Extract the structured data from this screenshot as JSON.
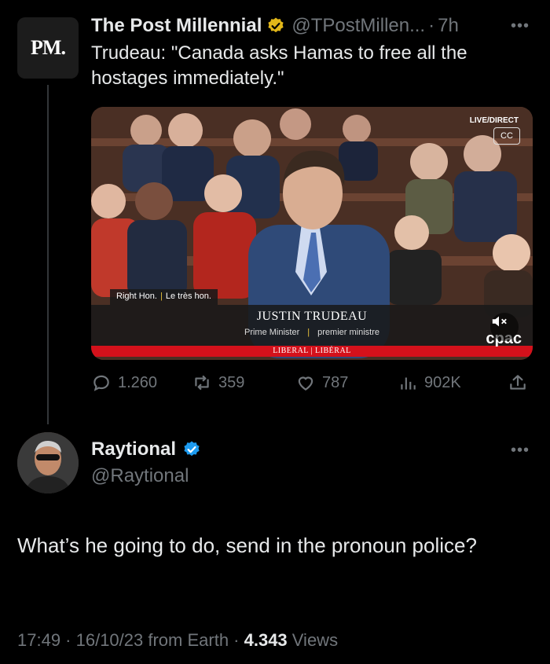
{
  "parent_tweet": {
    "avatar_text": "PM.",
    "name": "The Post Millennial",
    "handle": "@TPostMillen...",
    "time": "7h",
    "text": "Trudeau: \"Canada asks Hamas to free all the hostages immediately.\"",
    "media": {
      "live_tag": "LIVE/DIRECT",
      "cc_label": "CC",
      "title_left": "Right Hon.",
      "title_right": "Le très hon.",
      "speaker_name": "JUSTIN TRUDEAU",
      "role_en": "Prime Minister",
      "role_fr": "premier ministre",
      "party": "LIBERAL | LIBÉRAL",
      "broadcaster": "cpac"
    },
    "stats": {
      "replies": "1.260",
      "reposts": "359",
      "likes": "787",
      "views": "902K"
    }
  },
  "reply_tweet": {
    "name": "Raytional",
    "handle": "@Raytional",
    "text": "What’s he going to do, send in the pronoun police?",
    "meta_time": "17:49 · 16/10/23 from Earth · ",
    "meta_views_count": "4.343",
    "meta_views_label": " Views"
  },
  "colors": {
    "background": "#000000",
    "text_primary": "#e7e9ea",
    "text_secondary": "#71767b",
    "verified_gold": "#e2b719",
    "verified_blue": "#1d9bf0",
    "party_red": "#d4111b"
  },
  "icons": [
    "more-icon",
    "gold-verified-icon",
    "blue-verified-icon",
    "reply-icon",
    "repost-icon",
    "like-icon",
    "views-icon",
    "share-icon",
    "mute-icon",
    "cc-icon"
  ]
}
